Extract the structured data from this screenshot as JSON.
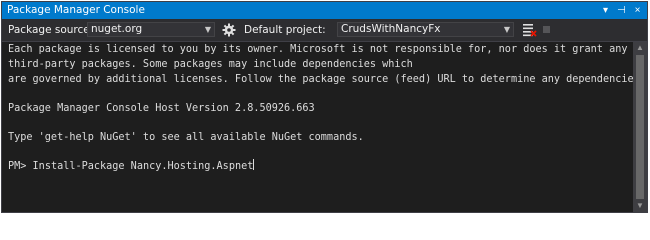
{
  "window": {
    "title": "Package Manager Console",
    "title_buttons": {
      "dropdown": "▾",
      "pin": "⊣",
      "close": "×"
    }
  },
  "toolbar": {
    "source_label": "Package source:",
    "source_value": "nuget.org",
    "settings_icon": "gear-icon",
    "project_label": "Default project:",
    "project_value": "CrudsWithNancyFx",
    "clear_icon": "clear-console-icon",
    "stop_icon": "stop-icon"
  },
  "console": {
    "license_line_1": "Each package is licensed to you by its owner. Microsoft is not responsible for, nor does it grant any licenses to,",
    "license_line_2": "third-party packages. Some packages may include dependencies which",
    "license_line_3": "are governed by additional licenses. Follow the package source (feed) URL to determine any dependencies.",
    "version_line": "Package Manager Console Host Version 2.8.50926.663",
    "help_line": "Type 'get-help NuGet' to see all available NuGet commands.",
    "prompt": "PM> ",
    "command": "Install-Package Nancy.Hosting.Aspnet"
  },
  "colors": {
    "title_bar": "#007acc",
    "toolbar": "#2d2d30",
    "console_bg": "#1e1e1e",
    "console_text": "#dcdcdc"
  }
}
